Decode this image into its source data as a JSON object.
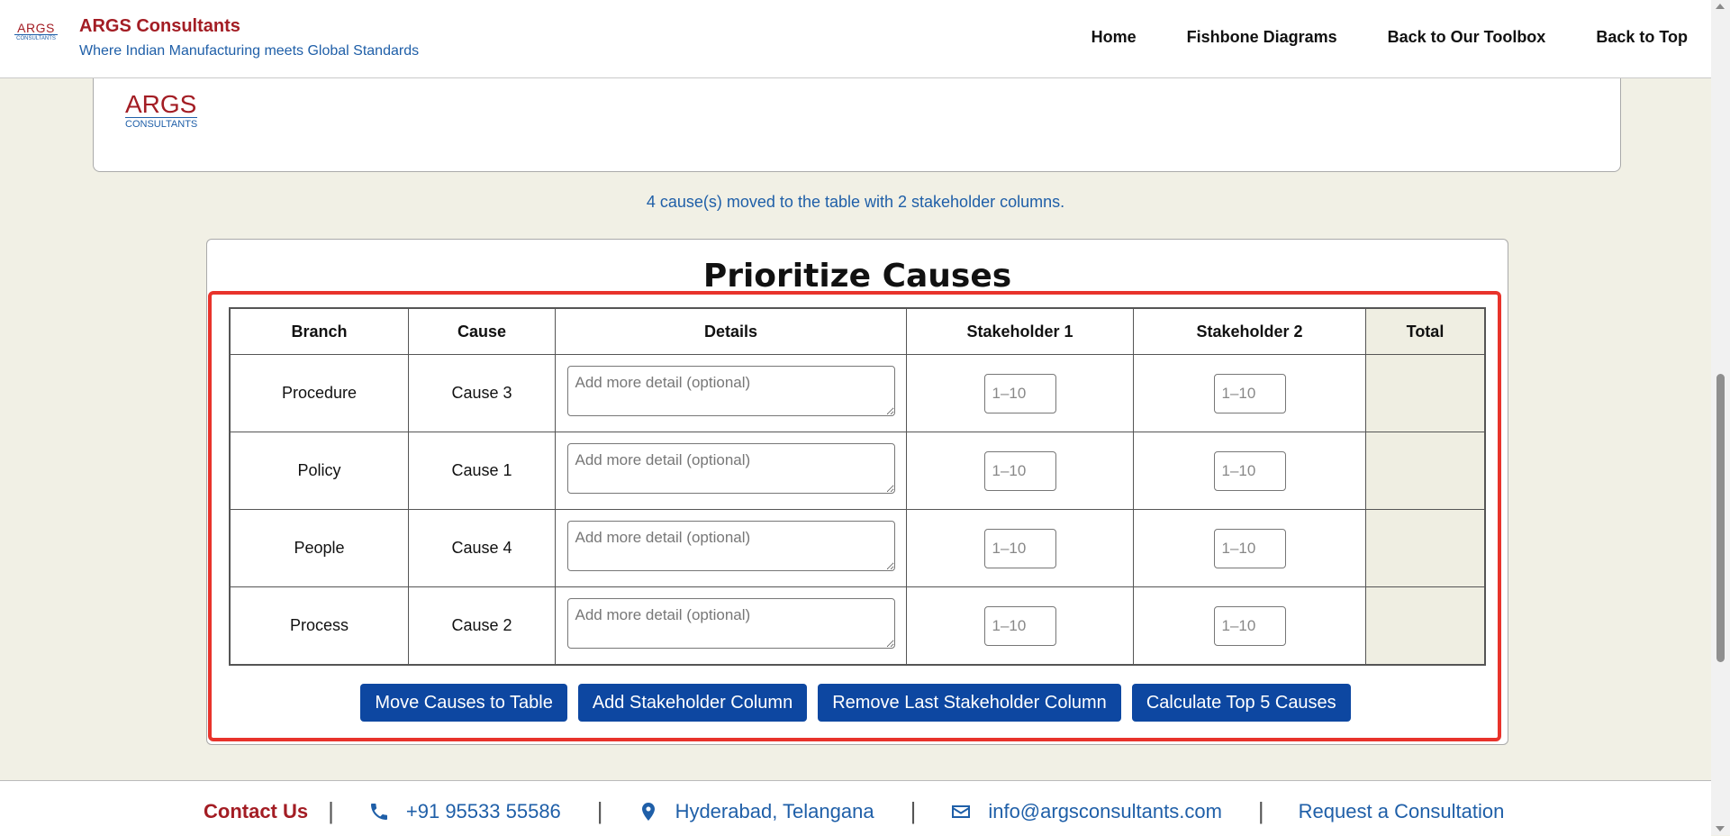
{
  "header": {
    "logo_top": "ARGS",
    "logo_bottom": "CONSULTANTS",
    "title": "ARGS Consultants",
    "tagline": "Where Indian Manufacturing meets Global Standards",
    "nav": [
      "Home",
      "Fishbone Diagrams",
      "Back to Our Toolbox",
      "Back to Top"
    ]
  },
  "card": {
    "logo_top": "ARGS",
    "logo_bottom": "CONSULTANTS"
  },
  "status_message": "4 cause(s) moved to the table with 2 stakeholder columns.",
  "panel": {
    "title": "Prioritize Causes",
    "columns": [
      "Branch",
      "Cause",
      "Details",
      "Stakeholder 1",
      "Stakeholder 2",
      "Total"
    ],
    "rows": [
      {
        "branch": "Procedure",
        "cause": "Cause 3",
        "details": "",
        "s1": "",
        "s2": "",
        "total": ""
      },
      {
        "branch": "Policy",
        "cause": "Cause 1",
        "details": "",
        "s1": "",
        "s2": "",
        "total": ""
      },
      {
        "branch": "People",
        "cause": "Cause 4",
        "details": "",
        "s1": "",
        "s2": "",
        "total": ""
      },
      {
        "branch": "Process",
        "cause": "Cause 2",
        "details": "",
        "s1": "",
        "s2": "",
        "total": ""
      }
    ],
    "details_placeholder": "Add more detail (optional)",
    "score_placeholder": "1–10",
    "buttons": [
      "Move Causes to Table",
      "Add Stakeholder Column",
      "Remove Last Stakeholder Column",
      "Calculate Top 5 Causes"
    ]
  },
  "footer": {
    "contact_label": "Contact Us",
    "phone": "+91 95533 55586",
    "location": "Hyderabad, Telangana",
    "email": "info@argsconsultants.com",
    "consult": "Request a Consultation",
    "separator": "|"
  },
  "colors": {
    "brand_red": "#a31d24",
    "brand_blue": "#1f5fa8",
    "button_blue": "#0d47a1",
    "highlight": "#e8332b"
  }
}
